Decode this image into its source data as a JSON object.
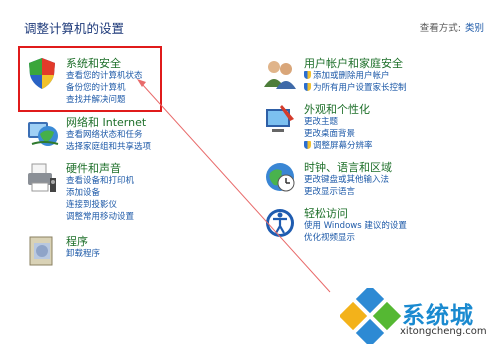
{
  "title": "调整计算机的设置",
  "view_by": {
    "label": "查看方式:",
    "value": "类别"
  },
  "categories": {
    "system": {
      "name": "系统和安全",
      "links": [
        "查看您的计算机状态",
        "备份您的计算机",
        "查找并解决问题"
      ]
    },
    "network": {
      "name": "网络和 Internet",
      "links": [
        "查看网络状态和任务",
        "选择家庭组和共享选项"
      ]
    },
    "hardware": {
      "name": "硬件和声音",
      "links": [
        "查看设备和打印机",
        "添加设备",
        "连接到投影仪",
        "调整常用移动设置"
      ]
    },
    "programs": {
      "name": "程序",
      "links": [
        "卸载程序"
      ]
    },
    "users": {
      "name": "用户帐户和家庭安全",
      "links": [
        "添加或删除用户帐户",
        "为所有用户设置家长控制"
      ]
    },
    "appearance": {
      "name": "外观和个性化",
      "links": [
        "更改主题",
        "更改桌面背景",
        "调整屏幕分辨率"
      ]
    },
    "clock": {
      "name": "时钟、语言和区域",
      "links": [
        "更改键盘或其他输入法",
        "更改显示语言"
      ]
    },
    "ease": {
      "name": "轻松访问",
      "links": [
        "使用 Windows 建议的设置",
        "优化视频显示"
      ]
    }
  },
  "watermark": {
    "text": "系统城",
    "url": "xitongcheng.com"
  }
}
